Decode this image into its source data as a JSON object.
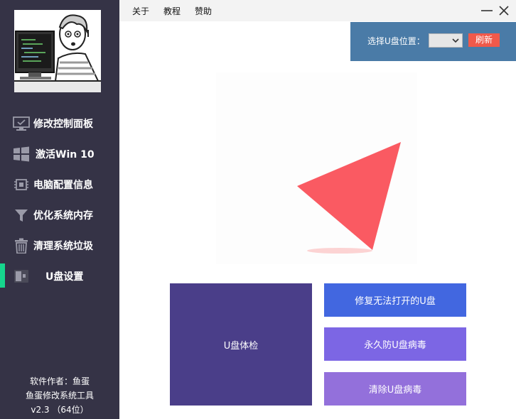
{
  "sidebar": {
    "items": [
      {
        "label": "修改控制面板",
        "icon": "monitor-check-icon"
      },
      {
        "label": "激活Win 10",
        "icon": "windows-logo-icon"
      },
      {
        "label": "电脑配置信息",
        "icon": "cpu-chip-icon"
      },
      {
        "label": "优化系统内存",
        "icon": "funnel-icon"
      },
      {
        "label": "清理系统垃圾",
        "icon": "trash-icon"
      },
      {
        "label": "U盘设置",
        "icon": "usb-drive-icon",
        "active": true
      }
    ],
    "footer": {
      "author": "软件作者：鱼蛋",
      "app_name": "鱼蛋修改系统工具",
      "version": "v2.3 （64位）"
    }
  },
  "menubar": {
    "items": [
      "关于",
      "教程",
      "赞助"
    ]
  },
  "usb_panel": {
    "label": "选择U盘位置：",
    "select_value": "",
    "refresh_label": "刷新"
  },
  "actions": {
    "check": "U盘体检",
    "repair": "修复无法打开的U盘",
    "protect": "永久防U盘病毒",
    "clean": "清除U盘病毒"
  },
  "colors": {
    "sidebar_bg": "#353346",
    "active_indicator": "#16d68d",
    "panel_bg": "#4a7ba7",
    "refresh_btn": "#f0594a",
    "triangle": "#fa5a62",
    "tile_check": "#4a3e89",
    "tile_repair": "#4267e0",
    "tile_protect": "#7c66e4",
    "tile_clean": "#9370db"
  }
}
